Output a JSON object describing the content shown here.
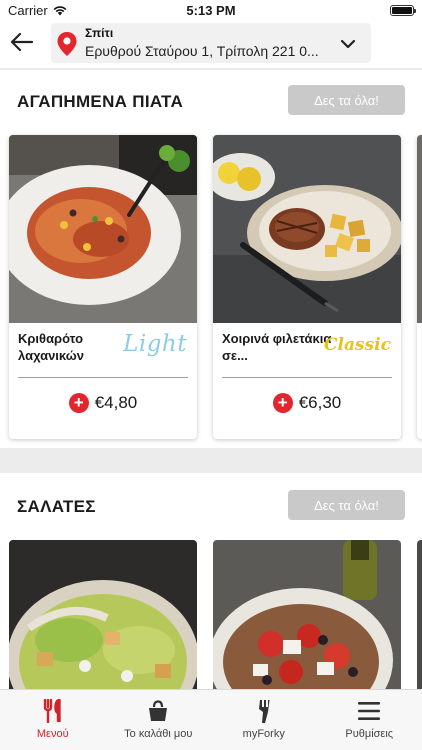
{
  "status_bar": {
    "carrier": "Carrier",
    "time": "5:13 PM"
  },
  "header": {
    "address_label": "Σπίτι",
    "address": "Ερυθρού Σταύρου 1, Τρίπολη 221 0..."
  },
  "sections": [
    {
      "title": "ΑΓΑΠΗΜΕΝΑ ΠΙΑΤΑ",
      "see_all": "Δες τα όλα!",
      "items": [
        {
          "name": "Κριθαρότο λαχανικών",
          "badge": "Light",
          "price": "€4,80"
        },
        {
          "name": "Χοιρινά φιλετάκια σε...",
          "badge": "Classic",
          "price": "€6,30"
        }
      ]
    },
    {
      "title": "ΣΑΛΑΤΕΣ",
      "see_all": "Δες τα όλα!"
    }
  ],
  "tabs": [
    {
      "label": "Μενού",
      "icon": "cutlery-icon",
      "active": true
    },
    {
      "label": "Το καλάθι μου",
      "icon": "basket-icon",
      "active": false
    },
    {
      "label": "myForky",
      "icon": "forky-logo-icon",
      "active": false
    },
    {
      "label": "Ρυθμίσεις",
      "icon": "menu-lines-icon",
      "active": false
    }
  ],
  "colors": {
    "accent_red": "#e2262e",
    "badge_light": "#8ccce6",
    "badge_classic": "#e8c21a",
    "see_all_bg": "#c9c9c9"
  }
}
